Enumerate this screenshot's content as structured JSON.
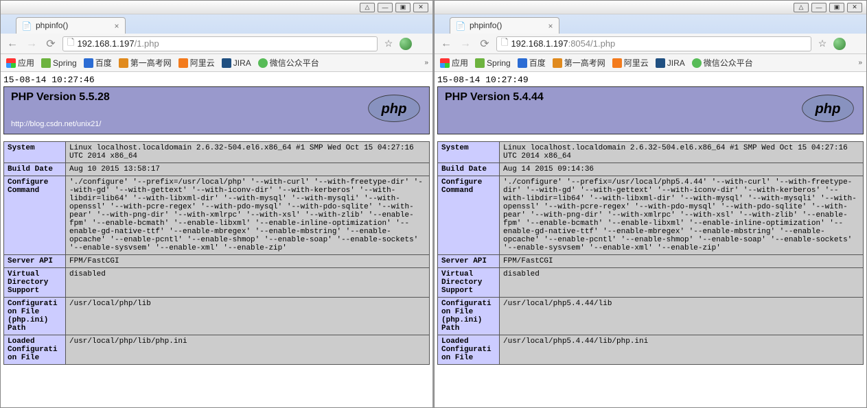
{
  "left": {
    "win_buttons": [
      "user",
      "min",
      "max",
      "close"
    ],
    "tab_title": "phpinfo()",
    "url_host": "192.168.1.197",
    "url_path": "/1.php",
    "bookmarks": [
      {
        "label": "应用",
        "color": "#888"
      },
      {
        "label": "Spring",
        "color": "#6db33f"
      },
      {
        "label": "百度",
        "color": "#2b6cd4"
      },
      {
        "label": "第一高考网",
        "color": "#e08a1e"
      },
      {
        "label": "阿里云",
        "color": "#f37b1d"
      },
      {
        "label": "JIRA",
        "color": "#205081"
      },
      {
        "label": "微信公众平台",
        "color": "#58bc58"
      }
    ],
    "timestamp": "15-08-14 10:27:46",
    "php_version": "PHP Version 5.5.28",
    "sublink": "http://blog.csdn.net/unix21/",
    "rows": [
      {
        "k": "System",
        "v": "Linux localhost.localdomain 2.6.32-504.el6.x86_64 #1 SMP Wed Oct 15 04:27:16 UTC 2014 x86_64"
      },
      {
        "k": "Build Date",
        "v": "Aug 10 2015 13:58:17"
      },
      {
        "k": "Configure Command",
        "v": "'./configure' '--prefix=/usr/local/php' '--with-curl' '--with-freetype-dir' '--with-gd' '--with-gettext' '--with-iconv-dir' '--with-kerberos' '--with-libdir=lib64' '--with-libxml-dir' '--with-mysql' '--with-mysqli' '--with-openssl' '--with-pcre-regex' '--with-pdo-mysql' '--with-pdo-sqlite' '--with-pear' '--with-png-dir' '--with-xmlrpc' '--with-xsl' '--with-zlib' '--enable-fpm' '--enable-bcmath' '--enable-libxml' '--enable-inline-optimization' '--enable-gd-native-ttf' '--enable-mbregex' '--enable-mbstring' '--enable-opcache' '--enable-pcntl' '--enable-shmop' '--enable-soap' '--enable-sockets' '--enable-sysvsem' '--enable-xml' '--enable-zip'"
      },
      {
        "k": "Server API",
        "v": "FPM/FastCGI"
      },
      {
        "k": "Virtual Directory Support",
        "v": "disabled"
      },
      {
        "k": "Configuration File (php.ini) Path",
        "v": "/usr/local/php/lib"
      },
      {
        "k": "Loaded Configuration File",
        "v": "/usr/local/php/lib/php.ini"
      }
    ]
  },
  "right": {
    "win_buttons": [
      "user",
      "min",
      "max",
      "close"
    ],
    "tab_title": "phpinfo()",
    "url_host": "192.168.1.197",
    "url_port": ":8054",
    "url_path": "/1.php",
    "bookmarks": [
      {
        "label": "应用",
        "color": "#888"
      },
      {
        "label": "Spring",
        "color": "#6db33f"
      },
      {
        "label": "百度",
        "color": "#2b6cd4"
      },
      {
        "label": "第一高考网",
        "color": "#e08a1e"
      },
      {
        "label": "阿里云",
        "color": "#f37b1d"
      },
      {
        "label": "JIRA",
        "color": "#205081"
      },
      {
        "label": "微信公众平台",
        "color": "#58bc58"
      }
    ],
    "timestamp": "15-08-14 10:27:49",
    "php_version": "PHP Version 5.4.44",
    "rows": [
      {
        "k": "System",
        "v": "Linux localhost.localdomain 2.6.32-504.el6.x86_64 #1 SMP Wed Oct 15 04:27:16 UTC 2014 x86_64"
      },
      {
        "k": "Build Date",
        "v": "Aug 14 2015 09:14:36"
      },
      {
        "k": "Configure Command",
        "v": "'./configure' '--prefix=/usr/local/php5.4.44' '--with-curl' '--with-freetype-dir' '--with-gd' '--with-gettext' '--with-iconv-dir' '--with-kerberos' '--with-libdir=lib64' '--with-libxml-dir' '--with-mysql' '--with-mysqli' '--with-openssl' '--with-pcre-regex' '--with-pdo-mysql' '--with-pdo-sqlite' '--with-pear' '--with-png-dir' '--with-xmlrpc' '--with-xsl' '--with-zlib' '--enable-fpm' '--enable-bcmath' '--enable-libxml' '--enable-inline-optimization' '--enable-gd-native-ttf' '--enable-mbregex' '--enable-mbstring' '--enable-opcache' '--enable-pcntl' '--enable-shmop' '--enable-soap' '--enable-sockets' '--enable-sysvsem' '--enable-xml' '--enable-zip'"
      },
      {
        "k": "Server API",
        "v": "FPM/FastCGI"
      },
      {
        "k": "Virtual Directory Support",
        "v": "disabled"
      },
      {
        "k": "Configuration File (php.ini) Path",
        "v": "/usr/local/php5.4.44/lib"
      },
      {
        "k": "Loaded Configuration File",
        "v": "/usr/local/php5.4.44/lib/php.ini"
      }
    ]
  }
}
